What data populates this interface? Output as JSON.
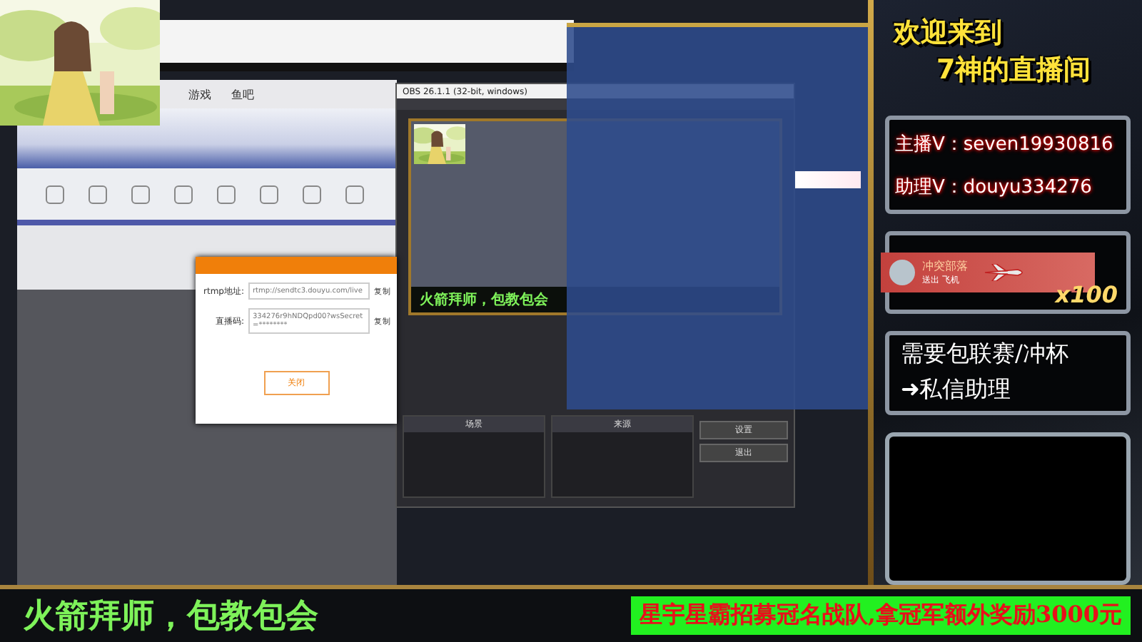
{
  "desktop": {
    "browser": {
      "nav": [
        "游戏",
        "鱼吧"
      ]
    },
    "dialog": {
      "fields": [
        {
          "label": "rtmp地址:",
          "value": "rtmp://sendtc3.douyu.com/live",
          "action": "复制"
        },
        {
          "label": "直播码:",
          "value": "334276r9hNDQpd00?wsSecret=********",
          "action": "复制"
        }
      ],
      "button": "关闭"
    },
    "obs": {
      "title": "OBS 26.1.1 (32-bit, windows)",
      "preview_caption": "火箭拜师，包教包会",
      "panels": [
        "场景",
        "来源"
      ],
      "controls": [
        "设置",
        "退出"
      ]
    }
  },
  "side": {
    "welcome": [
      "欢迎来到",
      "7神的直播间"
    ],
    "contacts": [
      "主播V：seven19930816",
      "助理V：douyu334276"
    ],
    "gift": {
      "user": "冲突部落",
      "action": "送出 飞机",
      "count": "x100"
    },
    "notice": [
      "需要包联赛/冲杯",
      "➜私信助理"
    ]
  },
  "ticker": {
    "left": "火箭拜师，包教包会",
    "right": "星宇星霸招募冠名战队,拿冠军额外奖励3000元"
  }
}
